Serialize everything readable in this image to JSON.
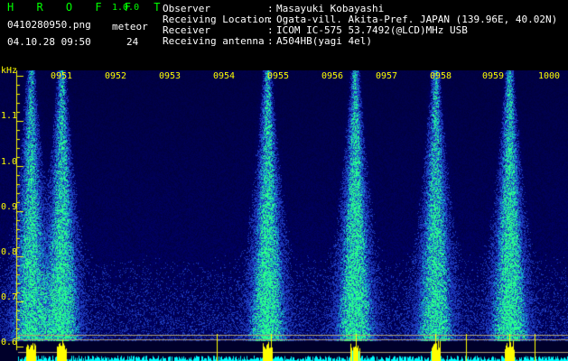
{
  "header": {
    "app_title": "H R O F F T",
    "app_version": "1.0.0",
    "file_name": "0410280950.png",
    "count_label": "meteor",
    "timestamp": "04.10.28 09:50",
    "count_value": "24"
  },
  "station_info": [
    {
      "label": "Observer",
      "value": "Masayuki Kobayashi"
    },
    {
      "label": "Receiving Location",
      "value": "Ogata-vill. Akita-Pref. JAPAN (139.96E, 40.02N)"
    },
    {
      "label": "Receiver",
      "value": "ICOM IC-575 53.7492(@LCD)MHz USB"
    },
    {
      "label": "Receiving antenna",
      "value": "A504HB(yagi 4el)"
    }
  ],
  "separator": ":",
  "spectrogram": {
    "y_unit": "kHz",
    "y_ticks": [
      "1.1",
      "1.0",
      "0.9",
      "0.8",
      "0.7",
      "0.6"
    ],
    "time_ticks": [
      "0951",
      "0952",
      "0953",
      "0954",
      "0955",
      "0956",
      "0957",
      "0958",
      "0959",
      "1000"
    ],
    "colors": {
      "background": "#000033",
      "noise": "#1a2f9c",
      "hot": "#22ff88",
      "peak": "#ffff00",
      "axis": "#ffff00"
    }
  }
}
